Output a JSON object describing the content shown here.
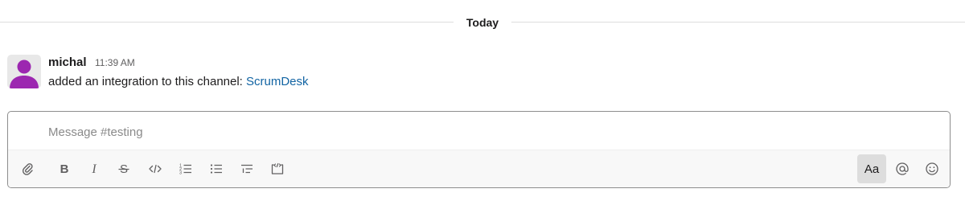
{
  "divider": {
    "label": "Today"
  },
  "message": {
    "author": "michal",
    "time": "11:39 AM",
    "text": "added an integration to this channel: ",
    "link": "ScrumDesk",
    "avatar_color": "#9c27b0"
  },
  "composer": {
    "placeholder": "Message #testing",
    "value": "",
    "toolbar": {
      "left": [
        "paperclip-icon",
        "bold-icon",
        "italic-icon",
        "strikethrough-icon",
        "code-icon",
        "ordered-list-icon",
        "bulleted-list-icon",
        "blockquote-icon",
        "code-block-icon"
      ],
      "format_label": "Aa",
      "right": [
        "at-mention-icon",
        "emoji-icon"
      ]
    }
  },
  "colors": {
    "link": "#1264a3",
    "text": "#1d1c1d",
    "muted": "#616061",
    "border": "#8d8d8d",
    "toolbar_bg": "#f8f8f8",
    "active_btn_bg": "#dddddd"
  }
}
